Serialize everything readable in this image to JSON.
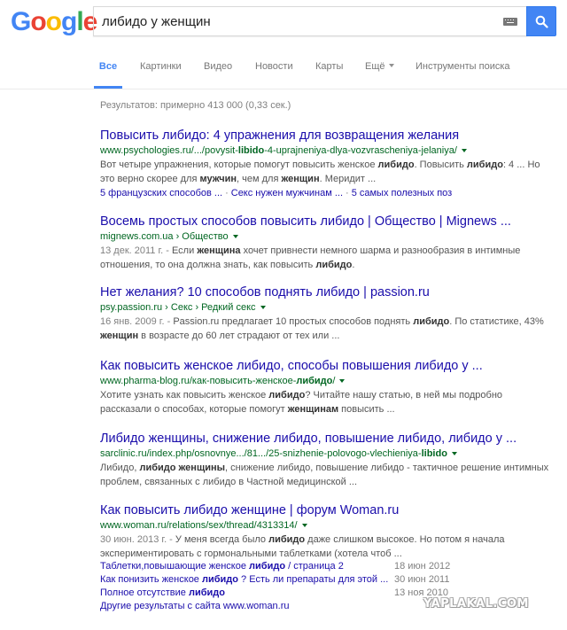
{
  "header": {
    "logo_letters": [
      "G",
      "o",
      "o",
      "g",
      "l",
      "e"
    ],
    "search_value": "либидо у женщин",
    "colors": {
      "blue": "#4285f4",
      "red": "#ea4335",
      "yellow": "#fbbc05",
      "green": "#34a853"
    }
  },
  "tabs": [
    {
      "label": "Все",
      "active": true
    },
    {
      "label": "Картинки"
    },
    {
      "label": "Видео"
    },
    {
      "label": "Новости"
    },
    {
      "label": "Карты"
    },
    {
      "label": "Ещё"
    },
    {
      "label": "Инструменты поиска"
    }
  ],
  "stats": "Результатов: примерно 413 000 (0,33 сек.)",
  "results": [
    {
      "title": "Повысить либидо: 4 упражнения для возвращения желания",
      "url_prefix": "www.psychologies.ru/.../povysit-",
      "url_bold": "libido",
      "url_suffix": "-4-uprajneniya-dlya-vozvrascheniya-jelaniya/",
      "snippet_line1": [
        {
          "t": "Вот четыре упражнения, которые помогут повысить женское "
        },
        {
          "t": "либидо",
          "b": true
        },
        {
          "t": ". Повысить "
        },
        {
          "t": "либидо",
          "b": true
        },
        {
          "t": ": 4 ... Но"
        }
      ],
      "snippet_line2": [
        {
          "t": "это верно скорее для "
        },
        {
          "t": "мужчин",
          "b": true
        },
        {
          "t": ", чем для "
        },
        {
          "t": "женщин",
          "b": true
        },
        {
          "t": ". Меридит ..."
        }
      ],
      "sitelinks": [
        "5 французских способов ...",
        "Секс нужен мужчинам ...",
        "5 самых полезных поз"
      ]
    },
    {
      "title": "Восемь простых способов повысить либидо | Общество | Mignews ...",
      "url": "mignews.com.ua › Общество",
      "date": "13 дек. 2011 г. - ",
      "snippet_line1": [
        {
          "t": "Если "
        },
        {
          "t": "женщина",
          "b": true
        },
        {
          "t": " хочет привнести немного шарма и разнообразия в интимные"
        }
      ],
      "snippet_line2": [
        {
          "t": "отношения, то она должна знать, как повысить "
        },
        {
          "t": "либидо",
          "b": true
        },
        {
          "t": "."
        }
      ]
    },
    {
      "title": "Нет желания? 10 способов поднять либидо | passion.ru",
      "url": "psy.passion.ru › Секс › Редкий секс",
      "date": "16 янв. 2009 г. - ",
      "snippet_line1": [
        {
          "t": "Passion.ru предлагает 10 простых способов поднять "
        },
        {
          "t": "либидо",
          "b": true
        },
        {
          "t": ". По статистике, 43%"
        }
      ],
      "snippet_line2": [
        {
          "t": "женщин",
          "b": true
        },
        {
          "t": " в возрасте до 60 лет страдают от тех или ..."
        }
      ]
    },
    {
      "title": "Как повысить женское либидо, способы повышения либидо у ...",
      "url_prefix": "www.pharma-blog.ru/как-повысить-женское-",
      "url_bold": "либидо",
      "url_suffix": "/",
      "snippet_line1": [
        {
          "t": "Хотите узнать как повысить женское "
        },
        {
          "t": "либидо",
          "b": true
        },
        {
          "t": "? Читайте нашу статью, в ней мы подробно"
        }
      ],
      "snippet_line2": [
        {
          "t": "рассказали о способах, которые помогут "
        },
        {
          "t": "женщинам",
          "b": true
        },
        {
          "t": " повысить ..."
        }
      ]
    },
    {
      "title": "Либидо женщины, снижение либидо, повышение либидо, либидо у ...",
      "url_prefix": "sarclinic.ru/index.php/osnovnye.../81.../25-snizhenie-polovogo-vlechieniya-",
      "url_bold": "libido",
      "url_suffix": "",
      "snippet_line1": [
        {
          "t": "Либидо, "
        },
        {
          "t": "либидо женщины",
          "b": true
        },
        {
          "t": ", снижение либидо, повышение либидо - тактичное решение интимных"
        }
      ],
      "snippet_line2": [
        {
          "t": "проблем, связанных с либидо в Частной медицинской ..."
        }
      ]
    },
    {
      "title": "Как повысить либидо женщине | форум Woman.ru",
      "url": "www.woman.ru/relations/sex/thread/4313314/",
      "date": "30 июн. 2013 г. - ",
      "snippet_line1": [
        {
          "t": "У меня всегда было "
        },
        {
          "t": "либидо",
          "b": true
        },
        {
          "t": " даже слишком высокое. Но потом я начала"
        }
      ],
      "snippet_line2": [
        {
          "t": "экспериментировать с гормональными таблетками (хотела чтоб ..."
        }
      ]
    }
  ],
  "sub_results": [
    {
      "pre": "Таблетки,повышающие женское ",
      "bold": "либидо",
      "post": " / страница 2",
      "date": "18 июн 2012"
    },
    {
      "pre": "Как понизить женское ",
      "bold": "либидо",
      "post": " ? Есть ли препараты для этой ...",
      "date": "30 июн 2011"
    },
    {
      "pre": "Полное отсутствие ",
      "bold": "либидо",
      "post": "",
      "date": "13 ноя 2010"
    }
  ],
  "more_from_site": "Другие результаты с сайта www.woman.ru",
  "watermark": "YAPLAKAL.COM"
}
